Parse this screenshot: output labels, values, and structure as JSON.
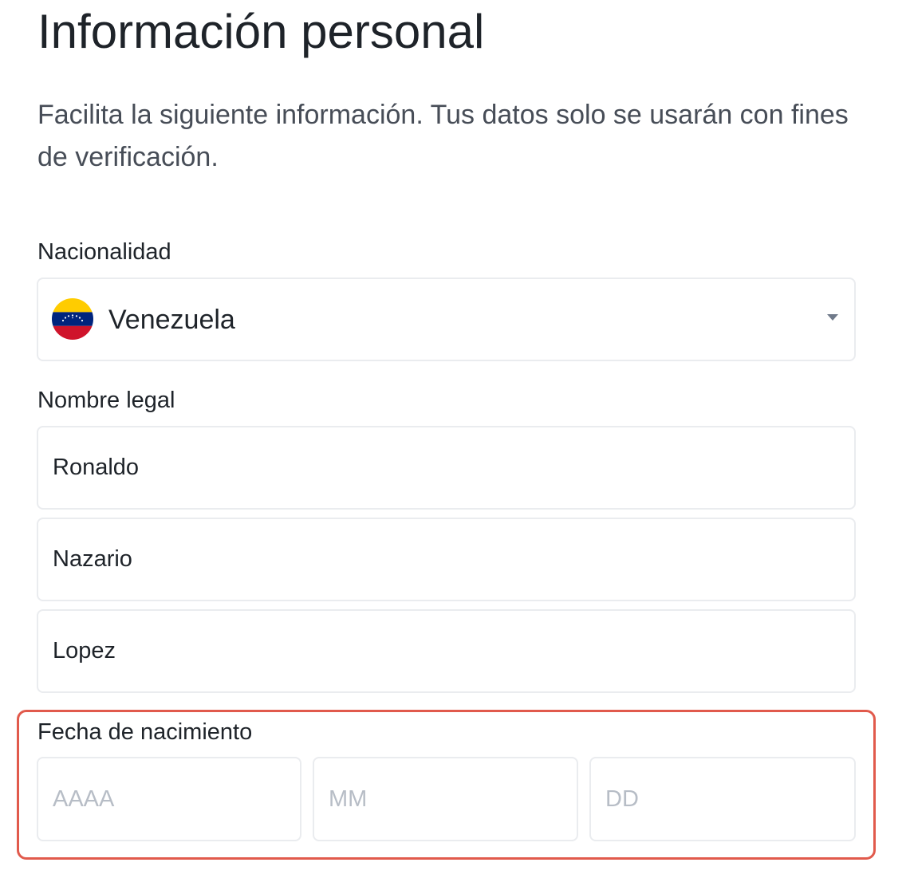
{
  "header": {
    "title": "Información personal",
    "subtitle": "Facilita la siguiente información. Tus datos solo se usarán con fines de verificación."
  },
  "nationality": {
    "label": "Nacionalidad",
    "selected": "Venezuela",
    "flag_icon": "venezuela-flag-icon",
    "caret_icon": "caret-down-icon",
    "flag_colors": [
      "#ffcc00",
      "#00247d",
      "#cf142b"
    ]
  },
  "legal_name": {
    "label": "Nombre legal",
    "first_name": "Ronaldo",
    "middle_name": "Nazario",
    "last_name": "Lopez"
  },
  "birth_date": {
    "label": "Fecha de nacimiento",
    "year_placeholder": "AAAA",
    "month_placeholder": "MM",
    "day_placeholder": "DD"
  },
  "colors": {
    "highlight_border": "#e15a4c",
    "field_border": "#eaecef",
    "placeholder": "#b7bdc6",
    "text_primary": "#1e2329",
    "text_secondary": "#474d57"
  }
}
